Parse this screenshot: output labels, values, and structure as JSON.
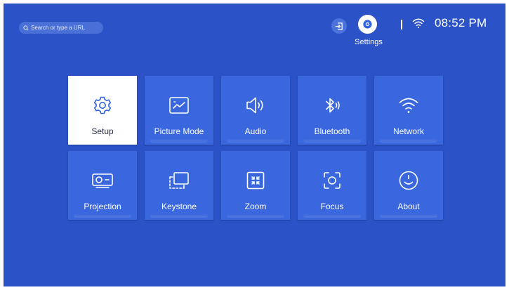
{
  "search": {
    "placeholder": "Search or type a URL"
  },
  "status_bar": {
    "settings_label": "Settings",
    "time": "08:52 PM"
  },
  "menu": {
    "tiles": [
      {
        "label": "Setup",
        "icon": "gear-icon",
        "selected": true
      },
      {
        "label": "Picture Mode",
        "icon": "picture-icon",
        "selected": false
      },
      {
        "label": "Audio",
        "icon": "speaker-icon",
        "selected": false
      },
      {
        "label": "Bluetooth",
        "icon": "bluetooth-icon",
        "selected": false
      },
      {
        "label": "Network",
        "icon": "wifi-icon",
        "selected": false
      },
      {
        "label": "Projection",
        "icon": "projector-icon",
        "selected": false
      },
      {
        "label": "Keystone",
        "icon": "keystone-icon",
        "selected": false
      },
      {
        "label": "Zoom",
        "icon": "zoom-icon",
        "selected": false
      },
      {
        "label": "Focus",
        "icon": "focus-icon",
        "selected": false
      },
      {
        "label": "About",
        "icon": "smiley-icon",
        "selected": false
      }
    ]
  },
  "colors": {
    "background": "#2b52c6",
    "tile": "#3a66de",
    "tile_selected": "#ffffff",
    "accent": "#3061e0"
  }
}
